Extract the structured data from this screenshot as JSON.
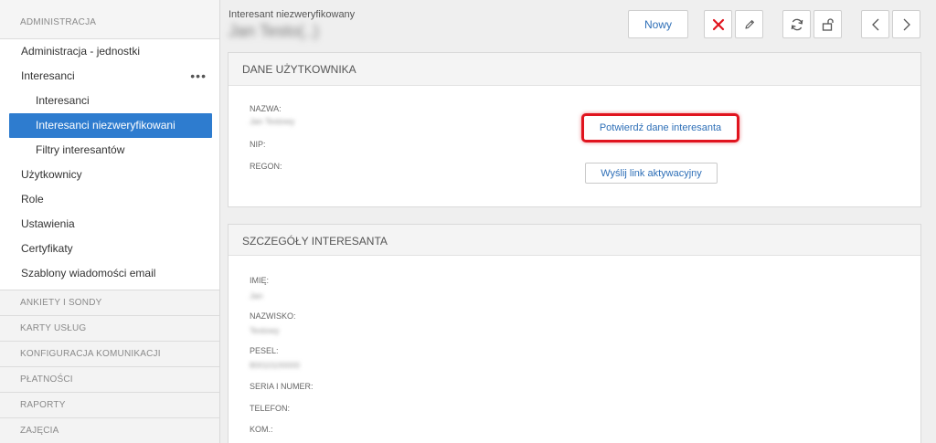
{
  "sidebar": {
    "section_admin": "ADMINISTRACJA",
    "items": [
      {
        "label": "Administracja - jednostki"
      },
      {
        "label": "Interesanci",
        "more": "•••"
      },
      {
        "label": "Interesanci"
      },
      {
        "label": "Interesanci niezweryfikowani"
      },
      {
        "label": "Filtry interesantów"
      },
      {
        "label": "Użytkownicy"
      },
      {
        "label": "Role"
      },
      {
        "label": "Ustawienia"
      },
      {
        "label": "Certyfikaty"
      },
      {
        "label": "Szablony wiadomości email"
      }
    ],
    "sections": [
      "ANKIETY I SONDY",
      "KARTY USŁUG",
      "KONFIGURACJA KOMUNIKACJI",
      "PŁATNOŚCI",
      "RAPORTY",
      "ZAJĘCIA"
    ]
  },
  "header": {
    "subtitle": "Interesant niezweryfikowany",
    "title": "Jan Testo(..)"
  },
  "toolbar": {
    "new_label": "Nowy",
    "icons": [
      "delete-icon",
      "edit-icon",
      "refresh-icon",
      "unlock-icon",
      "chevron-left-icon",
      "chevron-right-icon"
    ],
    "delete_color": "#e0141e"
  },
  "user_panel": {
    "title": "DANE UŻYTKOWNIKA",
    "fields": {
      "name_label": "NAZWA:",
      "name_value": "Jan Testowy",
      "nip_label": "NIP:",
      "regon_label": "REGON:"
    },
    "confirm_label": "Potwierdź dane interesanta",
    "send_link_label": "Wyślij link aktywacyjny",
    "highlight_color": "#e0141e"
  },
  "details_panel": {
    "title": "SZCZEGÓŁY INTERESANTA",
    "fields": {
      "first_name_label": "IMIĘ:",
      "first_name_value": "Jan",
      "last_name_label": "NAZWISKO:",
      "last_name_value": "Testowy",
      "pesel_label": "PESEL:",
      "pesel_value": "80010100000",
      "id_label": "SERIA I NUMER:",
      "phone_label": "TELEFON:",
      "mobile_label": "KOM.:"
    }
  },
  "colors": {
    "accent": "#2e7ccf",
    "link": "#2e6fb7"
  }
}
